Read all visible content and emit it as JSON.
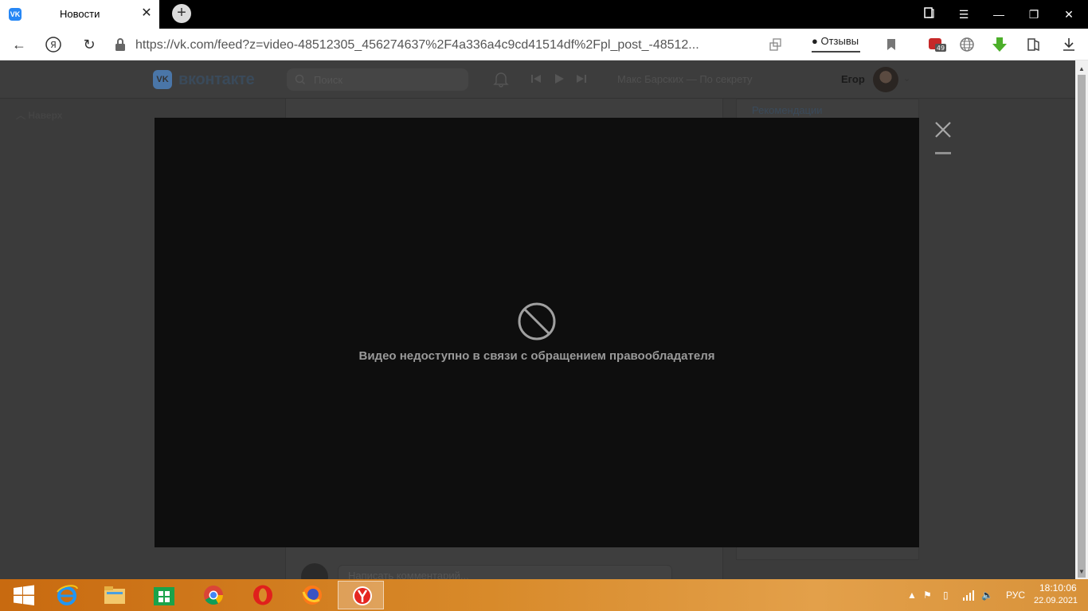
{
  "browser": {
    "tab_title": "Новости",
    "tab_favicon": "VK",
    "url": "https://vk.com/feed?z=video-48512305_456274637%2F4a336a4c9cd41514df%2Fpl_post_-48512...",
    "reviews_label": "Отзывы",
    "extension_badge": "49"
  },
  "vk": {
    "brand": "вконтакте",
    "search_placeholder": "Поиск",
    "track": "Макс Барских — По секрету",
    "user_name": "Егор",
    "back_to_top": "Наверх",
    "recommendations": "Рекомендации",
    "comment_placeholder": "Написать комментарий..."
  },
  "video": {
    "message": "Видео недоступно в связи с обращением правообладателя"
  },
  "taskbar": {
    "language": "РУС",
    "time": "18:10:06",
    "date": "22.09.2021"
  },
  "colors": {
    "accent": "#4a76a8",
    "taskbar": "#d88a2a",
    "video_bg": "#0e0e0e"
  }
}
